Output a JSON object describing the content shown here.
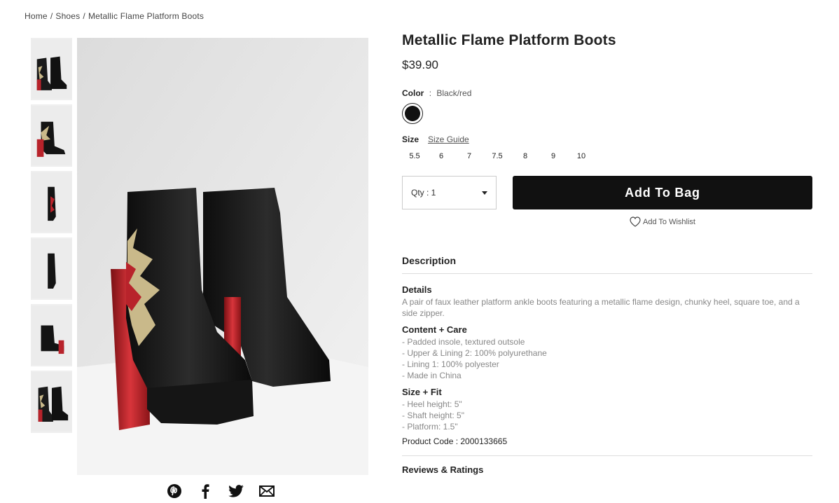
{
  "breadcrumb": {
    "home": "Home",
    "category": "Shoes",
    "current": "Metallic Flame Platform Boots",
    "separator": "/"
  },
  "product": {
    "title": "Metallic Flame Platform Boots",
    "price": "$39.90",
    "color_label": "Color",
    "color_sep": ":",
    "color_value": "Black/red",
    "size_label": "Size",
    "size_guide": "Size Guide",
    "sizes": [
      "5.5",
      "6",
      "7",
      "7.5",
      "8",
      "9",
      "10"
    ],
    "qty_label": "Qty : 1",
    "add_to_bag": "Add To Bag",
    "wishlist": "Add To Wishlist"
  },
  "description": {
    "heading": "Description",
    "details_title": "Details",
    "details_text": "A pair of faux leather platform ankle boots featuring a metallic flame design, chunky heel, square toe, and a side zipper.",
    "content_title": "Content + Care",
    "content_lines": [
      "- Padded insole, textured outsole",
      "- Upper & Lining 2: 100% polyurethane",
      "- Lining 1: 100% polyester",
      "- Made in China"
    ],
    "fit_title": "Size + Fit",
    "fit_lines": [
      "- Heel height: 5\"",
      "- Shaft height: 5\"",
      "- Platform: 1.5\""
    ],
    "product_code": "Product Code : 2000133665"
  },
  "reviews": {
    "heading": "Reviews & Ratings"
  },
  "share": [
    "pinterest-icon",
    "facebook-icon",
    "twitter-icon",
    "email-icon"
  ],
  "colors": {
    "accent": "#111111",
    "boot_red": "#b8232b",
    "flame_gold": "#c9b98a"
  }
}
